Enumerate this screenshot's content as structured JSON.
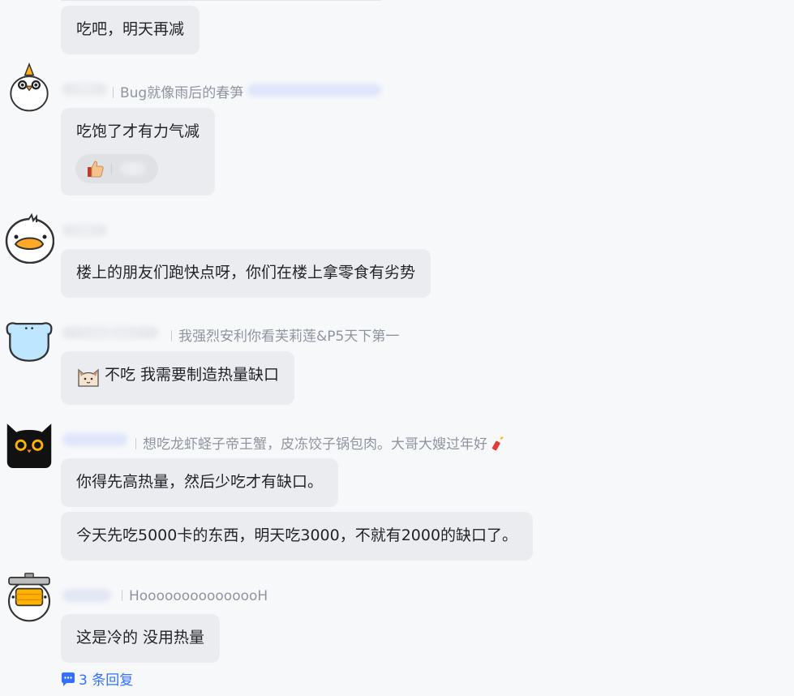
{
  "comments": [
    {
      "messages": [
        "吃吧，明天再减"
      ]
    },
    {
      "signature": "Bug就像雨后的春笋",
      "messages": [
        "吃饱了才有力气减"
      ],
      "reaction_icon": "thumbs-up-icon"
    },
    {
      "messages": [
        "楼上的朋友们跑快点呀，你们在楼上拿零食有劣势"
      ]
    },
    {
      "signature": "我强烈安利你看芙莉莲&P5天下第一",
      "messages": [
        "不吃 我需要制造热量缺口"
      ],
      "message_icon": "cat-face-icon"
    },
    {
      "signature": "想吃龙虾蛏子帝王蟹，皮冻饺子锅包肉。大哥大嫂过年好",
      "signature_icon": "firecracker-icon",
      "messages": [
        "你得先高热量，然后少吃才有缺口。",
        "今天先吃5000卡的东西，明天吃3000，不就有2000的缺口了。"
      ]
    },
    {
      "signature": "HooooooooooooooH",
      "messages": [
        "这是冷的 没用热量"
      ]
    }
  ],
  "replies_link": "3 条回复",
  "colors": {
    "accent": "#3370ff",
    "bubble": "#ebecef",
    "muted": "#8f959e"
  }
}
